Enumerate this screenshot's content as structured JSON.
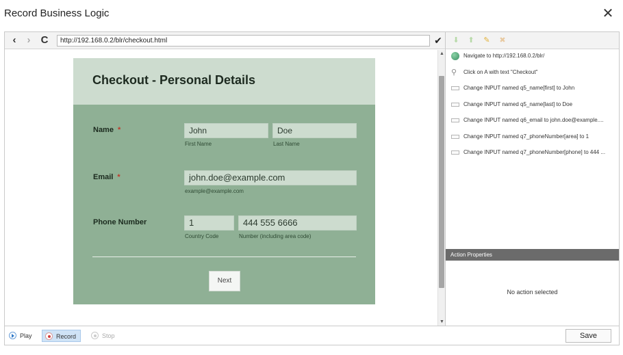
{
  "dialog": {
    "title": "Record Business Logic",
    "close_glyph": "✕"
  },
  "browser": {
    "back_glyph": "‹",
    "forward_glyph": "›",
    "reload_glyph": "C",
    "url": "http://192.168.0.2/blr/checkout.html",
    "go_glyph": "✔"
  },
  "form": {
    "title": "Checkout - Personal Details",
    "name_label": "Name",
    "required_mark": "*",
    "first_name_value": "John",
    "first_name_hint": "First Name",
    "last_name_value": "Doe",
    "last_name_hint": "Last Name",
    "email_label": "Email",
    "email_value": "john.doe@example.com",
    "email_hint": "example@example.com",
    "phone_label": "Phone Number",
    "country_code_value": "1",
    "country_code_hint": "Country Code",
    "number_value": "444 555 6666",
    "number_hint": "Number (including area code)",
    "next_label": "Next"
  },
  "actions_toolbar": {
    "icons": [
      "move-down-icon",
      "move-up-icon",
      "edit-icon",
      "delete-icon"
    ]
  },
  "actions": [
    {
      "icon": "globe-icon",
      "text": "Navigate to http://192.168.0.2/blr/"
    },
    {
      "icon": "cursor-icon",
      "text": "Click on A with text \"Checkout\""
    },
    {
      "icon": "input-field-icon",
      "text": "Change INPUT named q5_name[first] to John"
    },
    {
      "icon": "input-field-icon",
      "text": "Change INPUT named q5_name[last] to Doe"
    },
    {
      "icon": "input-field-icon",
      "text": "Change INPUT named q6_email to john.doe@example...."
    },
    {
      "icon": "input-field-icon",
      "text": "Change INPUT named q7_phoneNumber[area] to 1"
    },
    {
      "icon": "input-field-icon",
      "text": "Change INPUT named q7_phoneNumber[phone] to 444 ..."
    }
  ],
  "properties": {
    "header": "Action Properties",
    "empty_text": "No action selected"
  },
  "bottom_bar": {
    "play_label": "Play",
    "record_label": "Record",
    "stop_label": "Stop",
    "save_label": "Save"
  },
  "colors": {
    "form_body": "#8fb095",
    "form_header": "#cddccf",
    "required": "#c0392b",
    "record_active": "#cfe3f6"
  }
}
